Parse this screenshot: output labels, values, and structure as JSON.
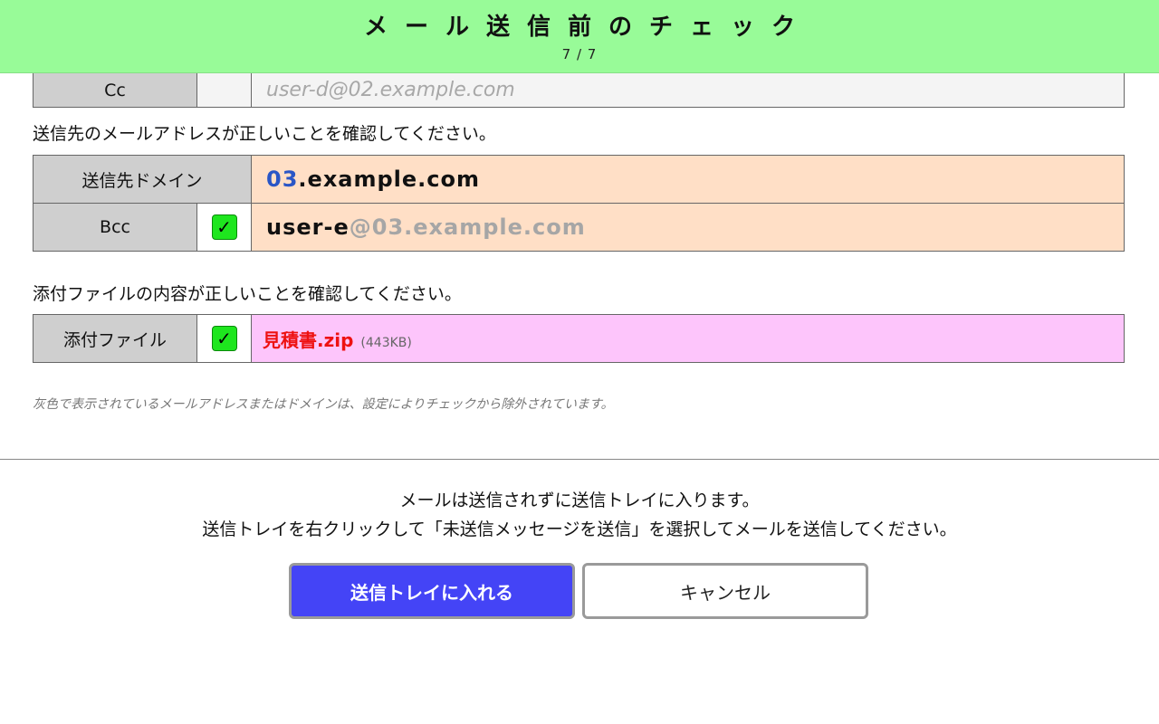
{
  "header": {
    "title": "メール送信前のチェック",
    "pager": "7 / 7"
  },
  "cc_row": {
    "label": "Cc",
    "address": "user-d@02.example.com"
  },
  "recipients_notice": "送信先のメールアドレスが正しいことを確認してください。",
  "destination": {
    "domain_label": "送信先ドメイン",
    "domain_highlight": "03",
    "domain_rest": ".example.com",
    "bcc_label": "Bcc",
    "bcc_user": "user-e",
    "bcc_domain": "@03.example.com",
    "bcc_checked": true
  },
  "attachment_notice": "添付ファイルの内容が正しいことを確認してください。",
  "attachment": {
    "label": "添付ファイル",
    "file_name": "見積書.zip",
    "file_size": "(443KB)",
    "checked": true
  },
  "footnote": "灰色で表示されているメールアドレスまたはドメインは、設定によりチェックから除外されています。",
  "info": {
    "line1": "メールは送信されずに送信トレイに入ります。",
    "line2": "送信トレイを右クリックして「未送信メッセージを送信」を選択してメールを送信してください。"
  },
  "buttons": {
    "confirm": "送信トレイに入れる",
    "cancel": "キャンセル"
  },
  "colors": {
    "header_bg": "#98fb98",
    "destination_bg": "#ffdfc6",
    "attachment_bg": "#fdc5fb",
    "primary_button": "#4444f6",
    "checkbox": "#1ee61e",
    "file_name": "#ee1111",
    "domain_highlight": "#2a56c6"
  },
  "icons": {
    "checkbox": "check-mark-icon"
  }
}
